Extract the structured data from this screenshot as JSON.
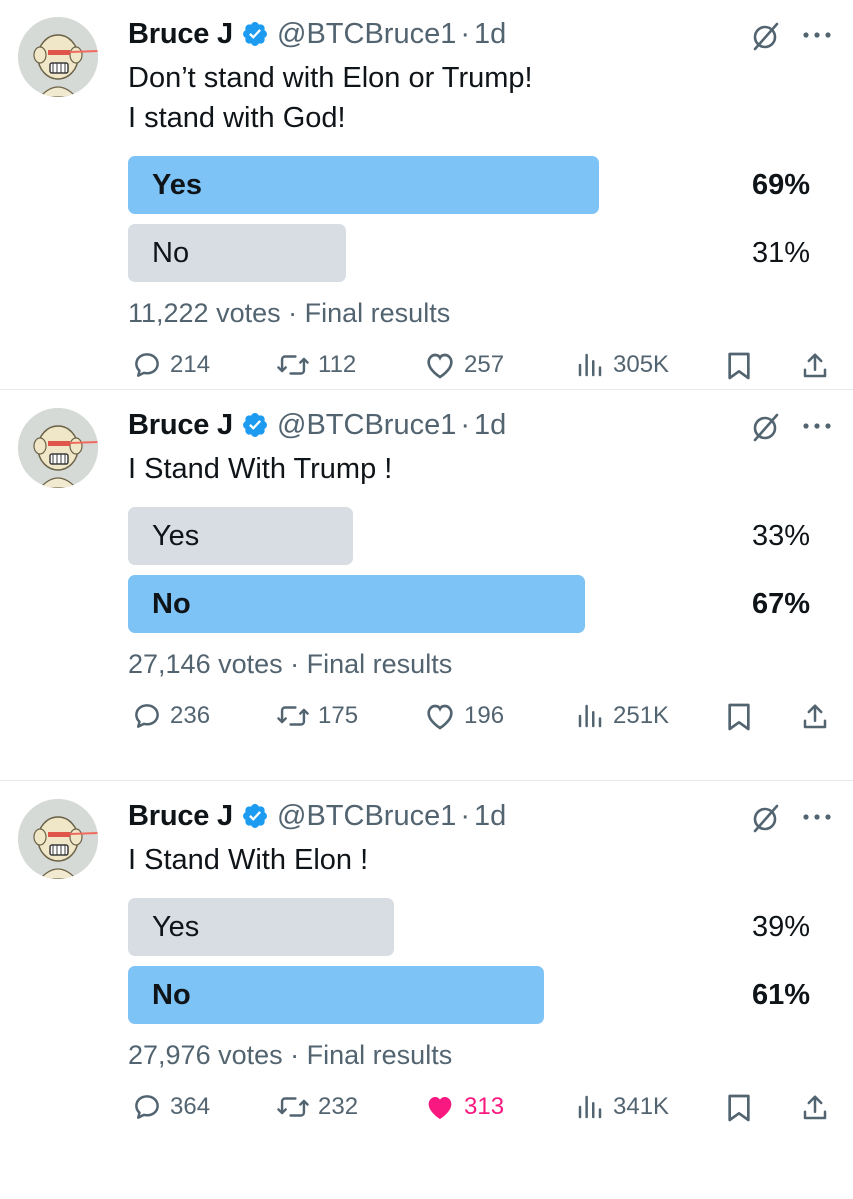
{
  "tweets": [
    {
      "name": "Bruce J",
      "handle": "@BTCBruce1",
      "separator": "·",
      "time": "1d",
      "text": "Don’t stand with Elon or Trump!\nI stand with God!",
      "options": [
        {
          "label": "Yes",
          "percent": "69%",
          "fraction": 0.69,
          "winner": true
        },
        {
          "label": "No",
          "percent": "31%",
          "fraction": 0.31,
          "winner": false
        }
      ],
      "votes": "11,222 votes",
      "status": "Final results",
      "replies": "214",
      "reposts": "112",
      "likes": "257",
      "liked": false,
      "views": "305K"
    },
    {
      "name": "Bruce J",
      "handle": "@BTCBruce1",
      "separator": "·",
      "time": "1d",
      "text": "I Stand With Trump !",
      "options": [
        {
          "label": "Yes",
          "percent": "33%",
          "fraction": 0.33,
          "winner": false
        },
        {
          "label": "No",
          "percent": "67%",
          "fraction": 0.67,
          "winner": true
        }
      ],
      "votes": "27,146 votes",
      "status": "Final results",
      "replies": "236",
      "reposts": "175",
      "likes": "196",
      "liked": false,
      "views": "251K"
    },
    {
      "name": "Bruce J",
      "handle": "@BTCBruce1",
      "separator": "·",
      "time": "1d",
      "text": "I Stand With Elon !",
      "options": [
        {
          "label": "Yes",
          "percent": "39%",
          "fraction": 0.39,
          "winner": false
        },
        {
          "label": "No",
          "percent": "61%",
          "fraction": 0.61,
          "winner": true
        }
      ],
      "votes": "27,976 votes",
      "status": "Final results",
      "replies": "364",
      "reposts": "232",
      "likes": "313",
      "liked": true,
      "views": "341K"
    }
  ],
  "colors": {
    "winner_bar": "#7dc3f5",
    "loser_bar": "#d7dde2",
    "secondary_text": "#536471",
    "verified_badge": "#1d9bf0",
    "like_active": "#f91880"
  },
  "icons": [
    "avatar-image",
    "verified-badge-icon",
    "grok-icon",
    "more-icon",
    "reply-icon",
    "repost-icon",
    "like-icon",
    "views-icon",
    "bookmark-icon",
    "share-icon"
  ]
}
